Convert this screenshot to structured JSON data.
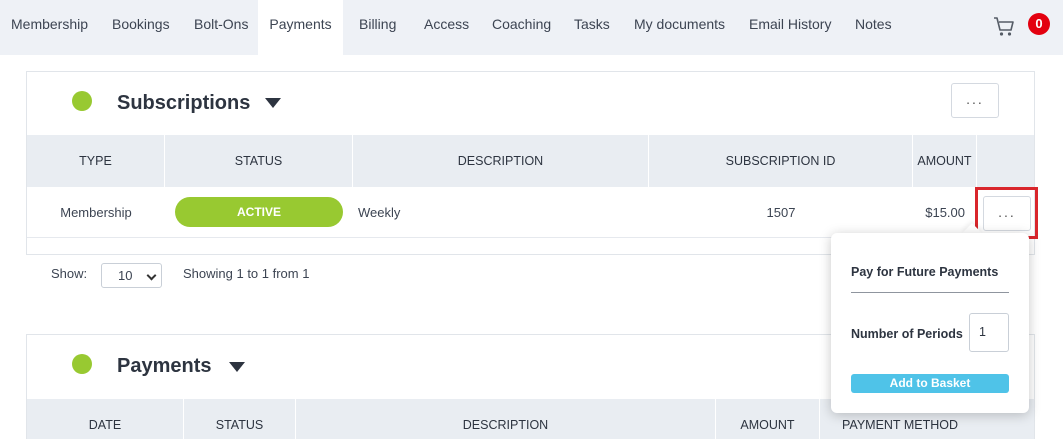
{
  "tabs": [
    {
      "label": "Membership"
    },
    {
      "label": "Bookings"
    },
    {
      "label": "Bolt-Ons"
    },
    {
      "label": "Payments",
      "active": true
    },
    {
      "label": "Billing"
    },
    {
      "label": "Access"
    },
    {
      "label": "Coaching"
    },
    {
      "label": "Tasks"
    },
    {
      "label": "My documents"
    },
    {
      "label": "Email History"
    },
    {
      "label": "Notes"
    }
  ],
  "cart": {
    "icon": "cart-icon",
    "count": "0"
  },
  "subscriptions": {
    "title": "Subscriptions",
    "more_label": "...",
    "columns": [
      "TYPE",
      "STATUS",
      "DESCRIPTION",
      "SUBSCRIPTION ID",
      "AMOUNT"
    ],
    "rows": [
      {
        "type": "Membership",
        "status": "ACTIVE",
        "description": "Weekly",
        "subscription_id": "1507",
        "amount": "$15.00",
        "more_label": "..."
      }
    ],
    "show_label": "Show:",
    "show_value": "10",
    "showing_text": "Showing 1 to 1 from 1"
  },
  "popup": {
    "title": "Pay for Future Payments",
    "periods_label": "Number of Periods",
    "periods_value": "1",
    "button_label": "Add to Basket"
  },
  "payments": {
    "title": "Payments",
    "columns": [
      "DATE",
      "STATUS",
      "DESCRIPTION",
      "AMOUNT",
      "PAYMENT METHOD"
    ]
  },
  "colors": {
    "active_green": "#98c931",
    "badge_red": "#e3000f",
    "highlight_red": "#d9262c",
    "button_blue": "#4fc3e8",
    "header_gray": "#e9edf2"
  }
}
